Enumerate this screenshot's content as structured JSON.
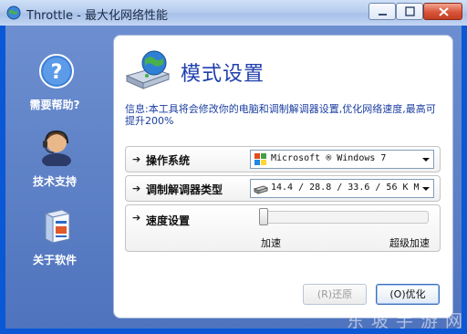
{
  "window": {
    "title": "Throttle - 最大化网络性能",
    "icons": {
      "app": "globe-icon",
      "minimize": "minimize-icon",
      "maximize": "maximize-icon",
      "close": "close-icon"
    }
  },
  "sidebar": {
    "items": [
      {
        "label": "需要帮助?",
        "icon": "help-icon"
      },
      {
        "label": "技术支持",
        "icon": "support-person-icon"
      },
      {
        "label": "关于软件",
        "icon": "software-box-icon"
      }
    ]
  },
  "main": {
    "title": "模式设置",
    "header_icon": "network-drive-globe-icon",
    "info": "信息:本工具将会修改你的电脑和调制解调器设置,优化网络速度,最高可提升200%",
    "rows": {
      "os": {
        "label": "操作系统",
        "value": "Microsoft ® Windows 7",
        "icon": "windows-flag-icon"
      },
      "modem": {
        "label": "调制解调器类型",
        "value": "14.4 / 28.8 / 33.6 / 56 K M",
        "icon": "modem-icon"
      },
      "speed": {
        "label": "速度设置",
        "min_label": "加速",
        "max_label": "超级加速",
        "value": 0
      }
    },
    "buttons": {
      "restore": "(R)还原",
      "optimize": "(O)优化"
    }
  },
  "watermark": "东 坡 手 游 网",
  "colors": {
    "accent": "#1f3fae",
    "frame": "#0a58d6",
    "sidebar": "#5a7fc6"
  }
}
